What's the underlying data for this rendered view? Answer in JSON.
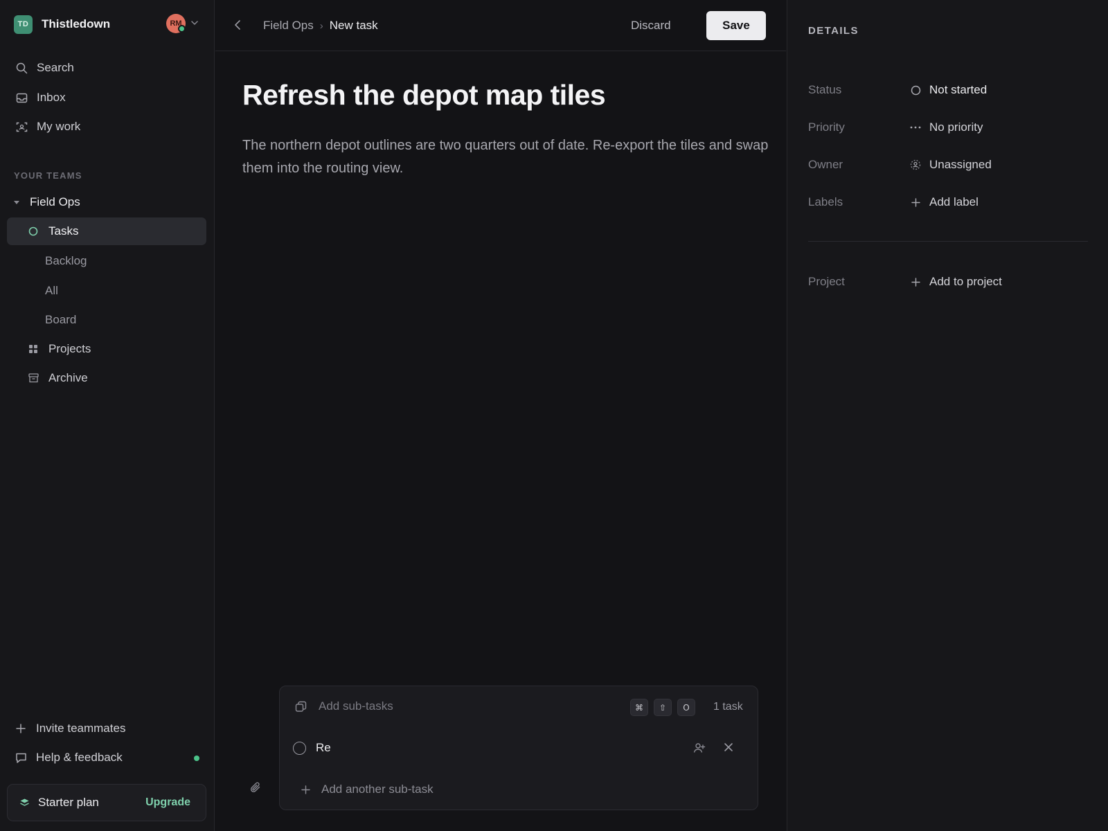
{
  "workspace": {
    "initials": "TD",
    "name": "Thistledown",
    "user_initials": "RM"
  },
  "nav": [
    {
      "label": "Search",
      "icon": "search-icon"
    },
    {
      "label": "Inbox",
      "icon": "inbox-icon"
    },
    {
      "label": "My work",
      "icon": "focus-icon"
    }
  ],
  "teams_section": "YOUR TEAMS",
  "team": {
    "name": "Field Ops",
    "tasks_label": "Tasks",
    "sub_items": [
      "Backlog",
      "All",
      "Board"
    ],
    "projects_label": "Projects",
    "archive_label": "Archive"
  },
  "footer": {
    "invite_label": "Invite teammates",
    "help_label": "Help & feedback",
    "plan_label": "Starter plan",
    "upgrade_label": "Upgrade"
  },
  "topbar": {
    "breadcrumb_team": "Field Ops",
    "breadcrumb_separator": "›",
    "breadcrumb_page": "New task",
    "discard_label": "Discard",
    "save_label": "Save"
  },
  "task": {
    "title": "Refresh the depot map tiles",
    "description": "The northern depot outlines are two quarters out of date. Re-export the tiles and swap them into the routing view."
  },
  "subtasks": {
    "placeholder": "Add sub-tasks",
    "shortcut_keys": [
      "⌘",
      "⇧",
      "O"
    ],
    "count_label": "1 task",
    "current_value": "Re",
    "add_another_label": "Add another sub-task"
  },
  "details": {
    "heading": "DETAILS",
    "status": {
      "key": "Status",
      "value": "Not started"
    },
    "priority": {
      "key": "Priority",
      "value": "No priority"
    },
    "owner": {
      "key": "Owner",
      "value": "Unassigned"
    },
    "labels": {
      "key": "Labels",
      "value": "Add label"
    },
    "project": {
      "key": "Project",
      "value": "Add to project"
    }
  },
  "colors": {
    "accent": "#3f8f73",
    "online": "#4cc38a",
    "upgrade": "#7fd0ac",
    "avatar": "#e0705f"
  }
}
